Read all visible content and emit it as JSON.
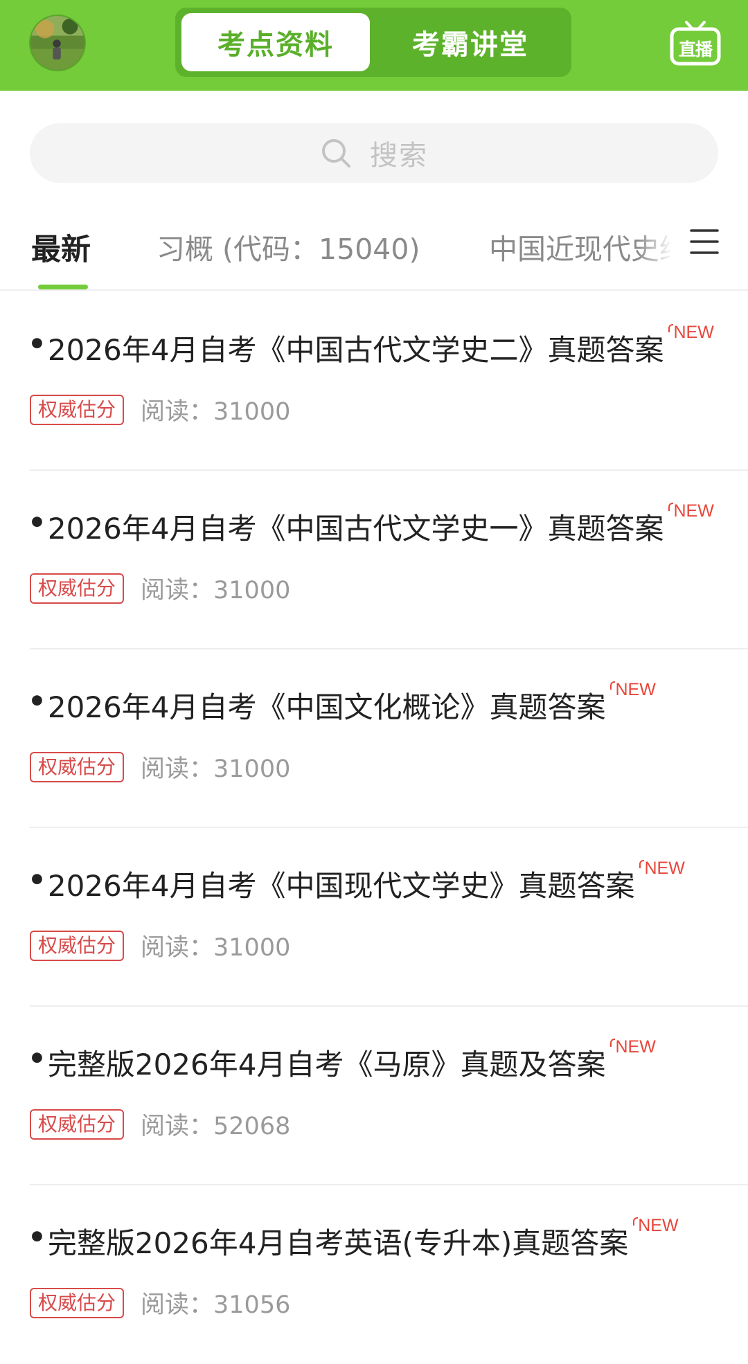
{
  "header": {
    "tabs": [
      {
        "label": "考点资料",
        "active": true
      },
      {
        "label": "考霸讲堂",
        "active": false
      }
    ],
    "live_label": "直播",
    "accent_color": "#74cc3a"
  },
  "search": {
    "placeholder": "搜索"
  },
  "categories": [
    {
      "label": "最新",
      "active": true
    },
    {
      "label": "习概 (代码：15040)",
      "active": false
    },
    {
      "label": "中国近现代史纲要",
      "active": false
    }
  ],
  "articles": [
    {
      "title": "2026年4月自考《中国古代文学史二》真题答案",
      "badge": "NEW",
      "tag": "权威估分",
      "reads": "阅读：31000"
    },
    {
      "title": "2026年4月自考《中国古代文学史一》真题答案",
      "badge": "NEW",
      "tag": "权威估分",
      "reads": "阅读：31000"
    },
    {
      "title": "2026年4月自考《中国文化概论》真题答案",
      "badge": "NEW",
      "tag": "权威估分",
      "reads": "阅读：31000"
    },
    {
      "title": "2026年4月自考《中国现代文学史》真题答案",
      "badge": "NEW",
      "tag": "权威估分",
      "reads": "阅读：31000"
    },
    {
      "title": "完整版2026年4月自考《马原》真题及答案",
      "badge": "NEW",
      "tag": "权威估分",
      "reads": "阅读：52068"
    },
    {
      "title": "完整版2026年4月自考英语(专升本)真题答案",
      "badge": "NEW",
      "tag": "权威估分",
      "reads": "阅读：31056"
    }
  ]
}
